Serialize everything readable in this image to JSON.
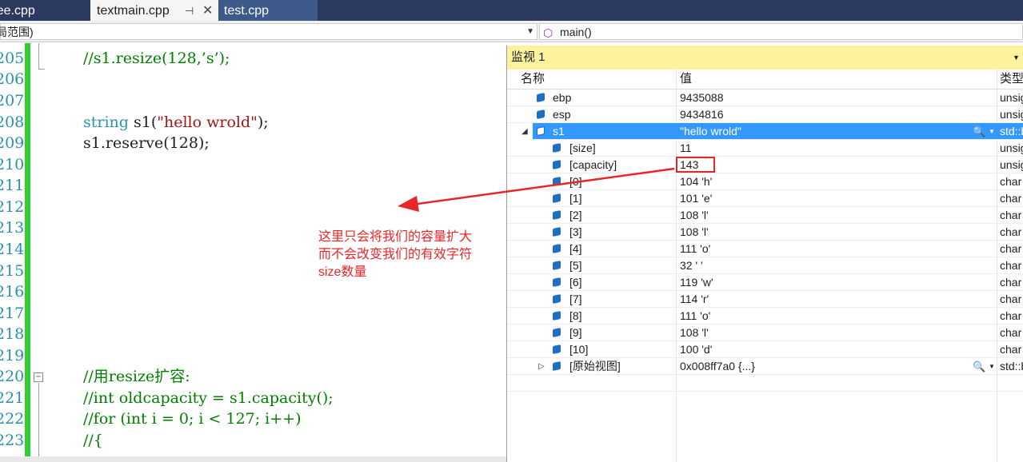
{
  "tabs": [
    {
      "label": "tree.cpp",
      "shown": "tree.cpp",
      "active": false
    },
    {
      "label": "textmain.cpp",
      "active": true
    },
    {
      "label": "test.cpp",
      "active": false
    }
  ],
  "nav": {
    "scope": "局范围)",
    "function": "main()"
  },
  "editor": {
    "line_numbers": [
      "205",
      "206",
      "207",
      "208",
      "209",
      "210",
      "211",
      "212",
      "213",
      "214",
      "215",
      "216",
      "217",
      "218",
      "219",
      "220",
      "221",
      "222",
      "223"
    ],
    "lines": {
      "l205": "//s1.resize(128,’s’);",
      "l208_kw": "string",
      "l208_a": " s1(",
      "l208_str": "\"hello wrold\"",
      "l208_b": ");",
      "l209": "s1.reserve(128);",
      "l220": "//用resize扩容:",
      "l221": "//int oldcapacity = s1.capacity();",
      "l222": "//for (int i = 0; i < 127; i++)",
      "l223": "//{"
    }
  },
  "annotation": {
    "line1": "这里只会将我们的容量扩大",
    "line2": "而不会改变我们的有效字符",
    "line3": "size数量"
  },
  "watch": {
    "title": "监视 1",
    "col_name": "名称",
    "col_value": "值",
    "col_type": "类型",
    "rows": [
      {
        "name": "ebp",
        "value": "9435088",
        "type": "unsig"
      },
      {
        "name": "esp",
        "value": "9434816",
        "type": "unsig"
      },
      {
        "name": "s1",
        "value": "\"hello wrold\"",
        "type": "std::b"
      },
      {
        "name": "[size]",
        "value": "11",
        "type": "unsig"
      },
      {
        "name": "[capacity]",
        "value": "143",
        "type": "unsig"
      },
      {
        "name": "[0]",
        "value": "104 'h'",
        "type": "char"
      },
      {
        "name": "[1]",
        "value": "101 'e'",
        "type": "char"
      },
      {
        "name": "[2]",
        "value": "108 'l'",
        "type": "char"
      },
      {
        "name": "[3]",
        "value": "108 'l'",
        "type": "char"
      },
      {
        "name": "[4]",
        "value": "111 'o'",
        "type": "char"
      },
      {
        "name": "[5]",
        "value": "32 ' '",
        "type": "char"
      },
      {
        "name": "[6]",
        "value": "119 'w'",
        "type": "char"
      },
      {
        "name": "[7]",
        "value": "114 'r'",
        "type": "char"
      },
      {
        "name": "[8]",
        "value": "111 'o'",
        "type": "char"
      },
      {
        "name": "[9]",
        "value": "108 'l'",
        "type": "char"
      },
      {
        "name": "[10]",
        "value": "100 'd'",
        "type": "char"
      },
      {
        "name": "[原始视图]",
        "value": "0x008ff7a0 {...}",
        "type": "std::b"
      }
    ]
  },
  "colors": {
    "tabbar": "#2b3a5e",
    "watch_title": "#fff29d",
    "selection": "#3399ff",
    "annotation": "#e8262a",
    "green_bar": "#33cc33"
  }
}
